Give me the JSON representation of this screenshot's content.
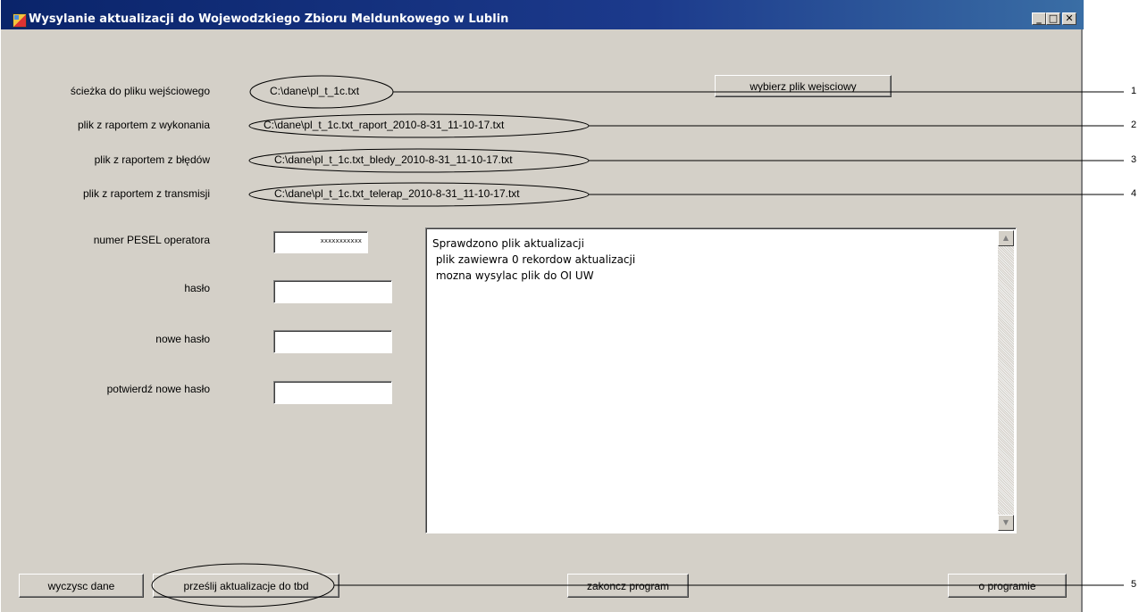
{
  "window": {
    "title": "Wysylanie aktualizacji do Wojewodzkiego Zbioru Meldunkowego w Lublin",
    "minimize_label": "_",
    "maximize_label": "□",
    "close_label": "✕"
  },
  "files": [
    {
      "label": "ścieżka do pliku wejściowego",
      "value": "C:\\dane\\pl_t_1c.txt"
    },
    {
      "label": "plik z raportem z wykonania",
      "value": "C:\\dane\\pl_t_1c.txt_raport_2010-8-31_11-10-17.txt"
    },
    {
      "label": "plik z raportem z błędów",
      "value": "C:\\dane\\pl_t_1c.txt_bledy_2010-8-31_11-10-17.txt"
    },
    {
      "label": "plik z raportem z transmisji",
      "value": "C:\\dane\\pl_t_1c.txt_telerap_2010-8-31_11-10-17.txt"
    }
  ],
  "choose_file_button": "wybierz plik wejsciowy",
  "form": {
    "pesel_label": "numer PESEL operatora",
    "pesel_value": "xxxxxxxxxxx",
    "password_label": "hasło",
    "new_password_label": "nowe hasło",
    "confirm_password_label": "potwierdź nowe hasło"
  },
  "log": {
    "lines": [
      "Sprawdzono plik aktualizacji",
      " plik zawiewra 0 rekordow aktualizacji",
      " mozna wysylac plik do OI UW"
    ],
    "scroll_up": "▲",
    "scroll_down": "▼"
  },
  "buttons": {
    "clear": "wyczysc dane",
    "send": "prześlij aktualizacje do tbd",
    "exit": "zakoncz program",
    "about": "o programie"
  },
  "annotation_markers": [
    "1",
    "2",
    "3",
    "4",
    "5"
  ]
}
